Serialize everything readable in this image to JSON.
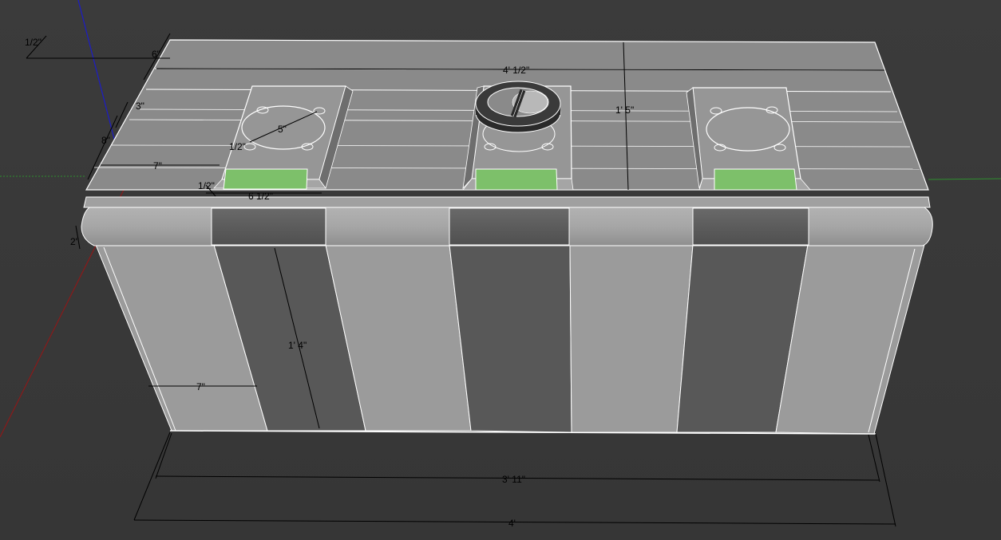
{
  "viewport": {
    "background": "#3a3a3a"
  },
  "colors": {
    "top_face": "#8a8a8a",
    "top_face_light": "#9a9a9a",
    "lip": "#a8a8a8",
    "side_light": "#9b9b9b",
    "side_dark": "#585858",
    "band_dark": "#5e5e5e",
    "edge": "#ffffff",
    "green_tag": "#7dc06a",
    "axis_red": "#8a1a1a",
    "axis_green": "#2f8f2f",
    "axis_blue": "#1c1cc8",
    "dim_line": "#000000"
  },
  "dimensions": {
    "d_half_top": "1/2\"",
    "d_6": "6\"",
    "d_4_half": "4' 1/2\"",
    "d_3": "3\"",
    "d_8": "8\"",
    "d_7_top": "7\"",
    "d_half_left": "1/2\"",
    "d_half_mid": "1/2\"",
    "d_5": "5\"",
    "d_6_half": "6 1/2\"",
    "d_1_5": "1' 5\"",
    "d_2": "2\"",
    "d_1_4": "1' 4\"",
    "d_7_side": "7\"",
    "d_3_11": "3' 11\"",
    "d_4": "4'"
  }
}
